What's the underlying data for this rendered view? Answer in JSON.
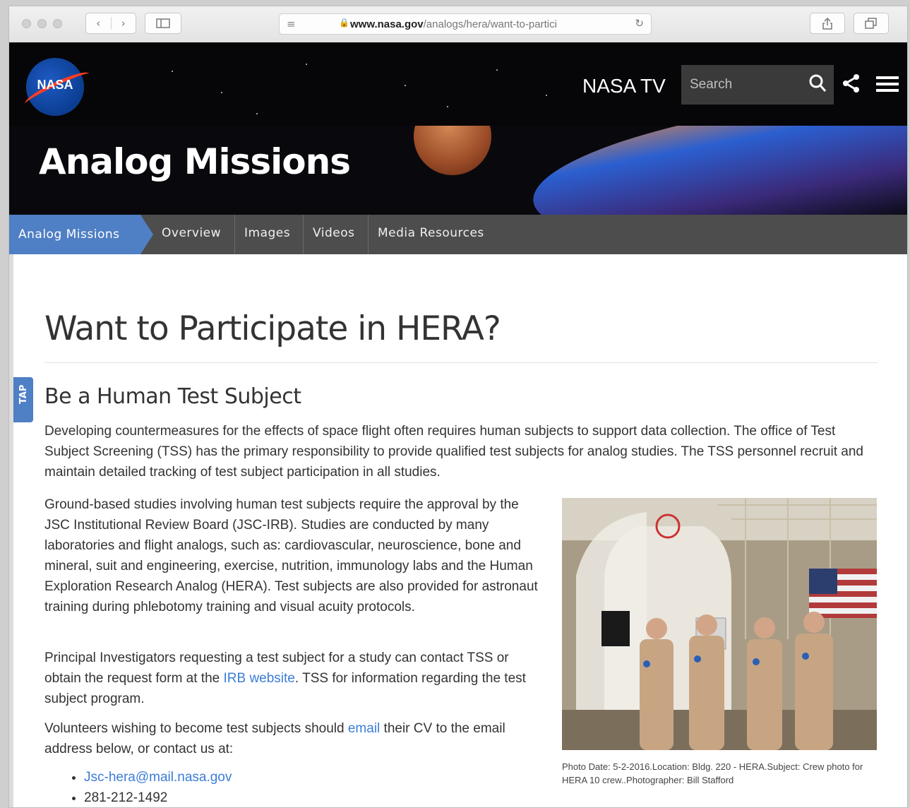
{
  "browser": {
    "url_domain": "www.nasa.gov",
    "url_path": "/analogs/hera/want-to-partici"
  },
  "header": {
    "logo_text": "NASA",
    "nasa_tv": "NASA TV",
    "search_placeholder": "Search"
  },
  "hero": {
    "title": "Analog Missions"
  },
  "subnav": {
    "current": "Analog Missions",
    "items": [
      "Overview",
      "Images",
      "Videos",
      "Media Resources"
    ]
  },
  "tap_tab": "TAP",
  "page": {
    "title": "Want to Participate in HERA?",
    "subtitle": "Be a Human Test Subject",
    "p1": "Developing countermeasures for the effects of space flight often requires human subjects to support data collection. The office of Test Subject Screening (TSS) has the primary responsibility to provide qualified test subjects for analog studies. The TSS personnel recruit and maintain detailed tracking of test subject participation in all studies.",
    "p2": "Ground-based studies involving human test subjects require the approval by the JSC Institutional Review Board (JSC-IRB).  Studies are conducted by many laboratories and flight analogs, such as: cardiovascular, neuroscience, bone and mineral, suit and engineering, exercise, nutrition, immunology labs and the Human Exploration Research Analog (HERA). Test subjects are also provided for astronaut training during phlebotomy training and visual acuity protocols.",
    "p3_before": "Principal Investigators requesting a test subject for a study can contact TSS or obtain the request form at the ",
    "p3_link": "IRB website",
    "p3_after": ". TSS for information regarding the test subject program.",
    "p4_before": "Volunteers wishing to become test subjects should ",
    "p4_link": "email",
    "p4_after": " their CV to the email address below, or contact us at:",
    "contact_email": "Jsc-hera@mail.nasa.gov",
    "contact_phone": "281-212-1492",
    "photo_caption": "Photo Date: 5-2-2016.Location: Bldg. 220 - HERA.Subject: Crew photo for HERA 10 crew..Photographer: Bill Stafford"
  },
  "colors": {
    "accent_blue": "#4f7fc4",
    "link_blue": "#3b7dd8",
    "subnav_gray": "#4d4d4d",
    "header_black": "#060608"
  }
}
